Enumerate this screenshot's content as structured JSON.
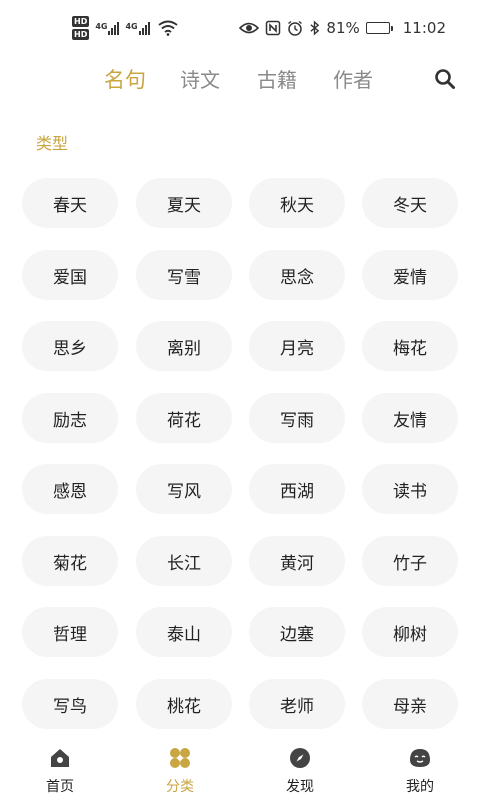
{
  "status_bar": {
    "hd1": "HD",
    "hd2": "HD",
    "net1": "4G",
    "net2": "4G",
    "battery_percent": "81%",
    "battery_level": 0.81,
    "time": "11:02"
  },
  "top_tabs": [
    {
      "label": "名句",
      "active": true
    },
    {
      "label": "诗文",
      "active": false
    },
    {
      "label": "古籍",
      "active": false
    },
    {
      "label": "作者",
      "active": false
    }
  ],
  "section_title": "类型",
  "categories": [
    "春天",
    "夏天",
    "秋天",
    "冬天",
    "爱国",
    "写雪",
    "思念",
    "爱情",
    "思乡",
    "离别",
    "月亮",
    "梅花",
    "励志",
    "荷花",
    "写雨",
    "友情",
    "感恩",
    "写风",
    "西湖",
    "读书",
    "菊花",
    "长江",
    "黄河",
    "竹子",
    "哲理",
    "泰山",
    "边塞",
    "柳树",
    "写鸟",
    "桃花",
    "老师",
    "母亲"
  ],
  "bottom_nav": [
    {
      "label": "首页",
      "icon": "home-icon",
      "active": false
    },
    {
      "label": "分类",
      "icon": "category-icon",
      "active": true
    },
    {
      "label": "发现",
      "icon": "compass-icon",
      "active": false
    },
    {
      "label": "我的",
      "icon": "profile-face-icon",
      "active": false
    }
  ],
  "colors": {
    "accent": "#c9a642",
    "chip_bg": "#f5f5f5",
    "inactive_tab": "#8a8a8a"
  }
}
